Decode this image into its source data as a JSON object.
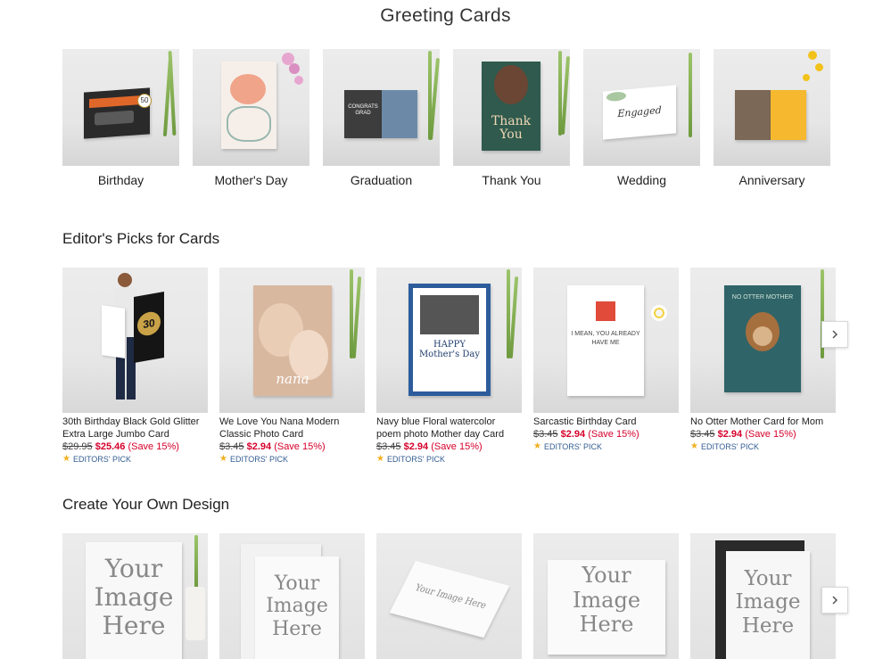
{
  "page_title": "Greeting Cards",
  "categories": [
    {
      "label": "Birthday"
    },
    {
      "label": "Mother's Day"
    },
    {
      "label": "Graduation"
    },
    {
      "label": "Thank You"
    },
    {
      "label": "Wedding"
    },
    {
      "label": "Anniversary"
    }
  ],
  "editors_picks": {
    "title": "Editor's Picks for Cards",
    "items": [
      {
        "name": "30th Birthday Black Gold Glitter Extra Large Jumbo Card",
        "old_price": "$29.95",
        "new_price": "$25.46",
        "save": "(Save 15%)",
        "badge": "EDITORS' PICK",
        "card_text": "30"
      },
      {
        "name": "We Love You Nana Modern Classic Photo Card",
        "old_price": "$3.45",
        "new_price": "$2.94",
        "save": "(Save 15%)",
        "badge": "EDITORS' PICK",
        "card_text": "nana"
      },
      {
        "name": "Navy blue Floral watercolor poem photo Mother day Card",
        "old_price": "$3.45",
        "new_price": "$2.94",
        "save": "(Save 15%)",
        "badge": "EDITORS' PICK",
        "card_text": "HAPPY Mother's Day"
      },
      {
        "name": "Sarcastic Birthday Card",
        "old_price": "$3.45",
        "new_price": "$2.94",
        "save": "(Save 15%)",
        "badge": "EDITORS' PICK",
        "card_text": "I MEAN, YOU ALREADY HAVE ME"
      },
      {
        "name": "No Otter Mother Card for Mom",
        "old_price": "$3.45",
        "new_price": "$2.94",
        "save": "(Save 15%)",
        "badge": "EDITORS' PICK",
        "card_text": "NO OTTER MOTHER"
      }
    ]
  },
  "create_own": {
    "title": "Create Your Own Design",
    "placeholder_text": "Your Image Here"
  },
  "card_texts": {
    "graduation": "CONGRATS GRAD",
    "thank_you": "Thank You",
    "wedding": "Engaged"
  },
  "colors": {
    "sale_red": "#d6002b",
    "badge_blue": "#335d92",
    "star_gold": "#f2b01e"
  }
}
